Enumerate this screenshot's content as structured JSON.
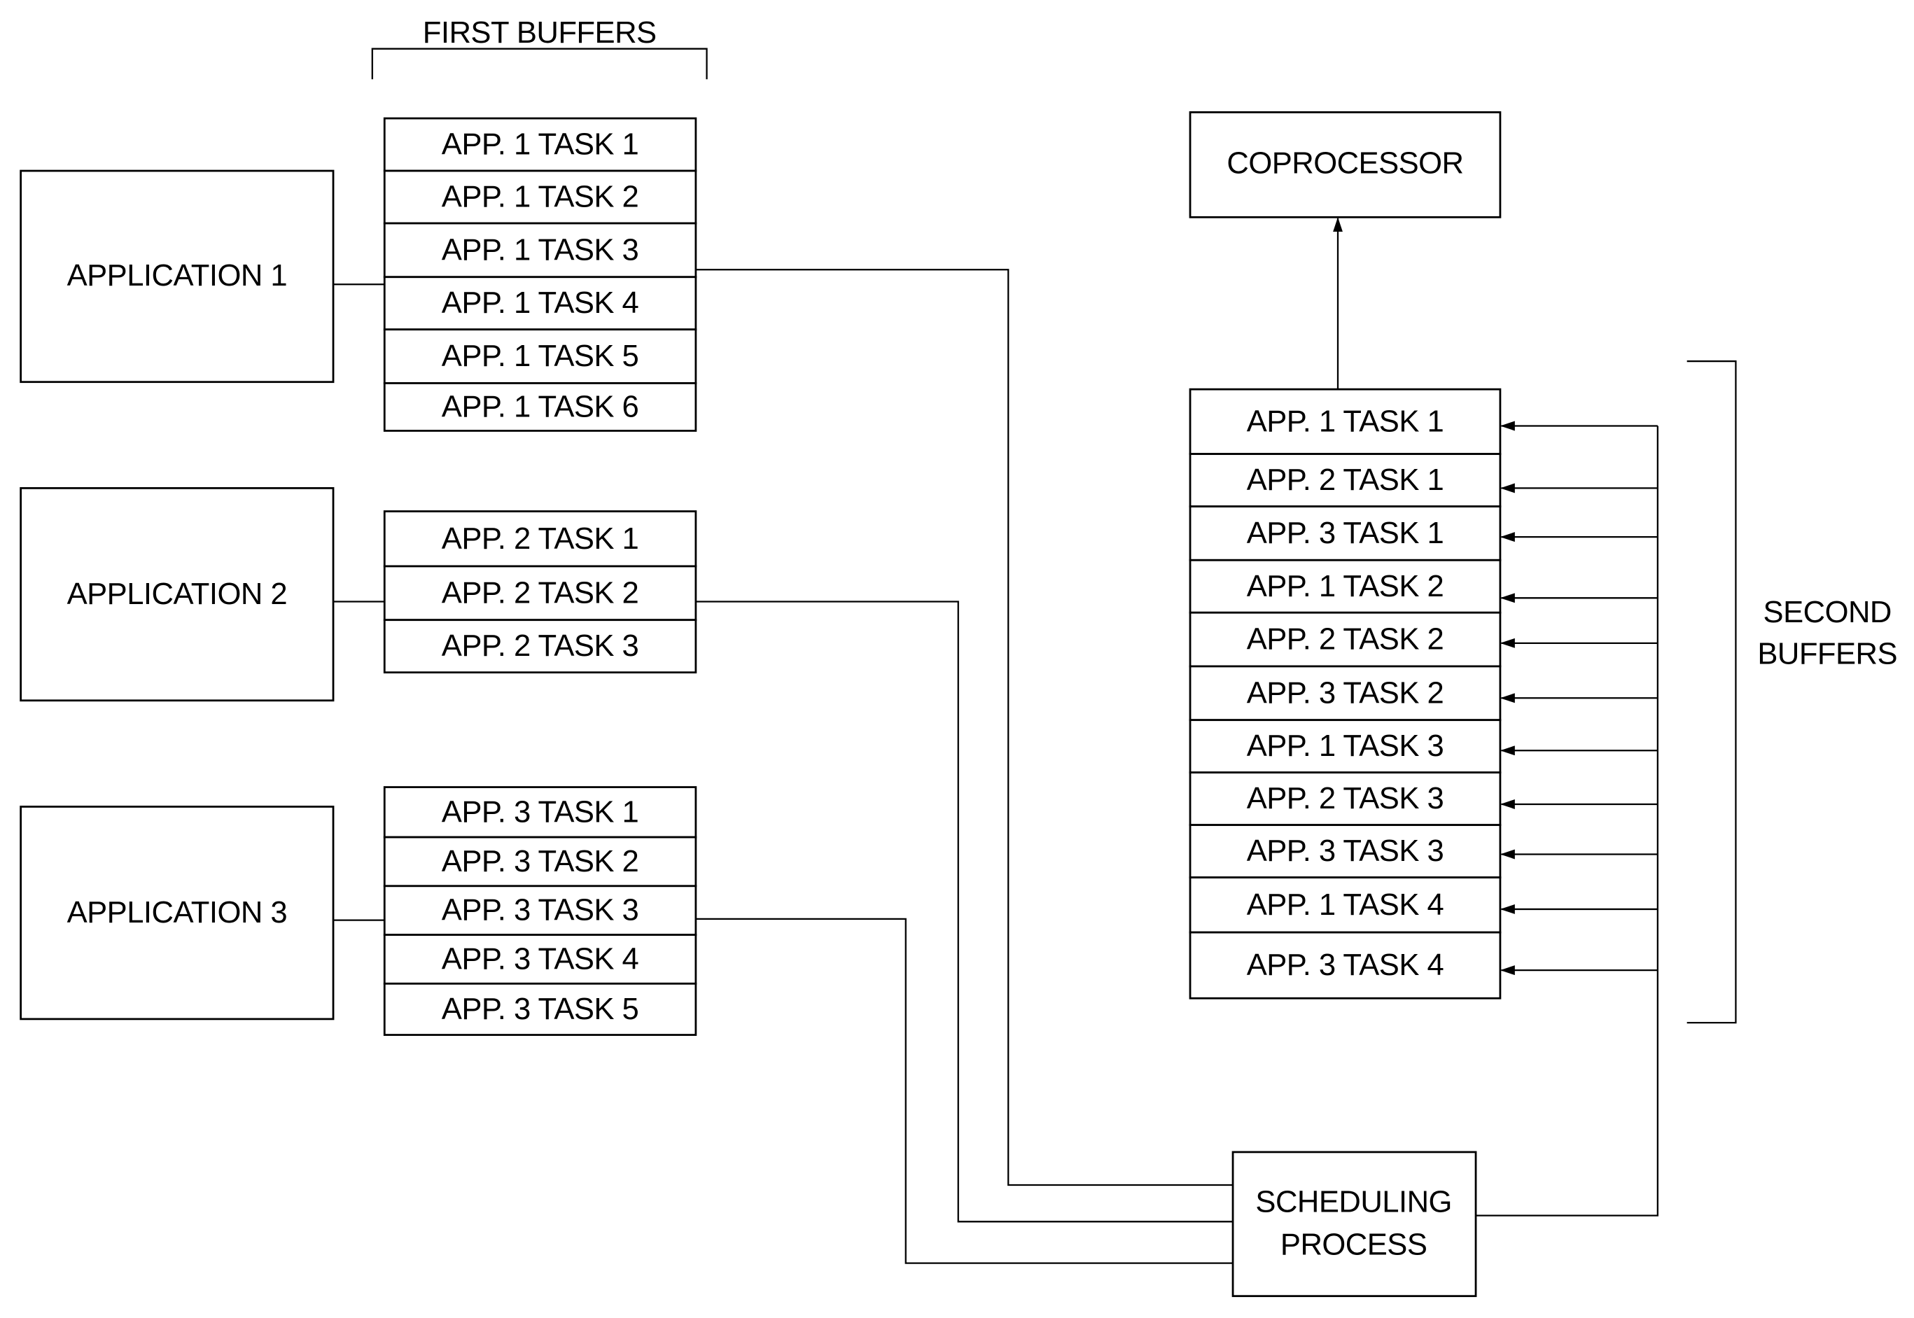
{
  "labels": {
    "first_buffers": "FIRST BUFFERS",
    "second_buffers_line1": "SECOND",
    "second_buffers_line2": "BUFFERS",
    "coprocessor": "COPROCESSOR",
    "scheduling_line1": "SCHEDULING",
    "scheduling_line2": "PROCESS"
  },
  "applications": [
    {
      "name": "APPLICATION 1",
      "tasks": [
        "APP. 1 TASK 1",
        "APP. 1 TASK 2",
        "APP. 1 TASK 3",
        "APP. 1 TASK 4",
        "APP. 1 TASK 5",
        "APP. 1 TASK 6"
      ]
    },
    {
      "name": "APPLICATION 2",
      "tasks": [
        "APP. 2 TASK 1",
        "APP. 2 TASK 2",
        "APP. 2 TASK 3"
      ]
    },
    {
      "name": "APPLICATION 3",
      "tasks": [
        "APP. 3 TASK 1",
        "APP. 3 TASK 2",
        "APP. 3 TASK 3",
        "APP. 3 TASK 4",
        "APP. 3 TASK 5"
      ]
    }
  ],
  "second_buffers": [
    "APP. 1 TASK 1",
    "APP. 2 TASK 1",
    "APP. 3 TASK 1",
    "APP. 1 TASK 2",
    "APP. 2 TASK 2",
    "APP. 3 TASK 2",
    "APP. 1 TASK 3",
    "APP. 2 TASK 3",
    "APP. 3 TASK 3",
    "APP. 1 TASK 4",
    "APP. 3 TASK 4"
  ]
}
